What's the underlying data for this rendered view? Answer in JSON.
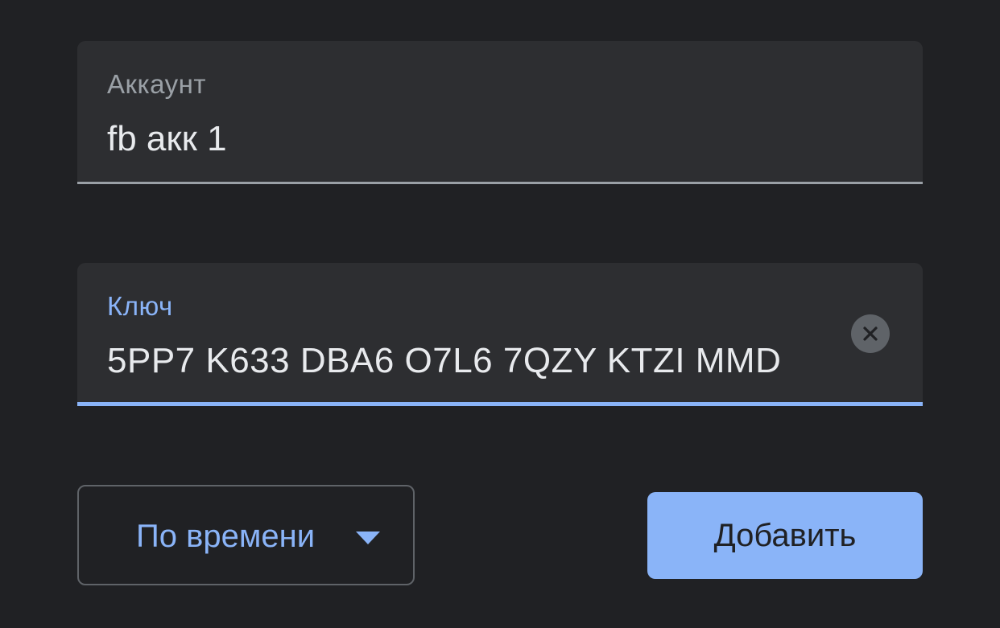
{
  "colors": {
    "background": "#202124",
    "field_background": "#2d2e31",
    "accent": "#8ab4f8",
    "muted": "#9aa0a6",
    "text": "#e8eaed"
  },
  "account_field": {
    "label": "Аккаунт",
    "value": "fb акк 1"
  },
  "key_field": {
    "label": "Ключ",
    "value": "5PP7 K633 DBA6 O7L6 7QZY KTZI MMD",
    "clear_icon": "close-icon"
  },
  "type_select": {
    "selected": "По времени",
    "icon": "dropdown-arrow-icon"
  },
  "add_button": {
    "label": "Добавить"
  }
}
